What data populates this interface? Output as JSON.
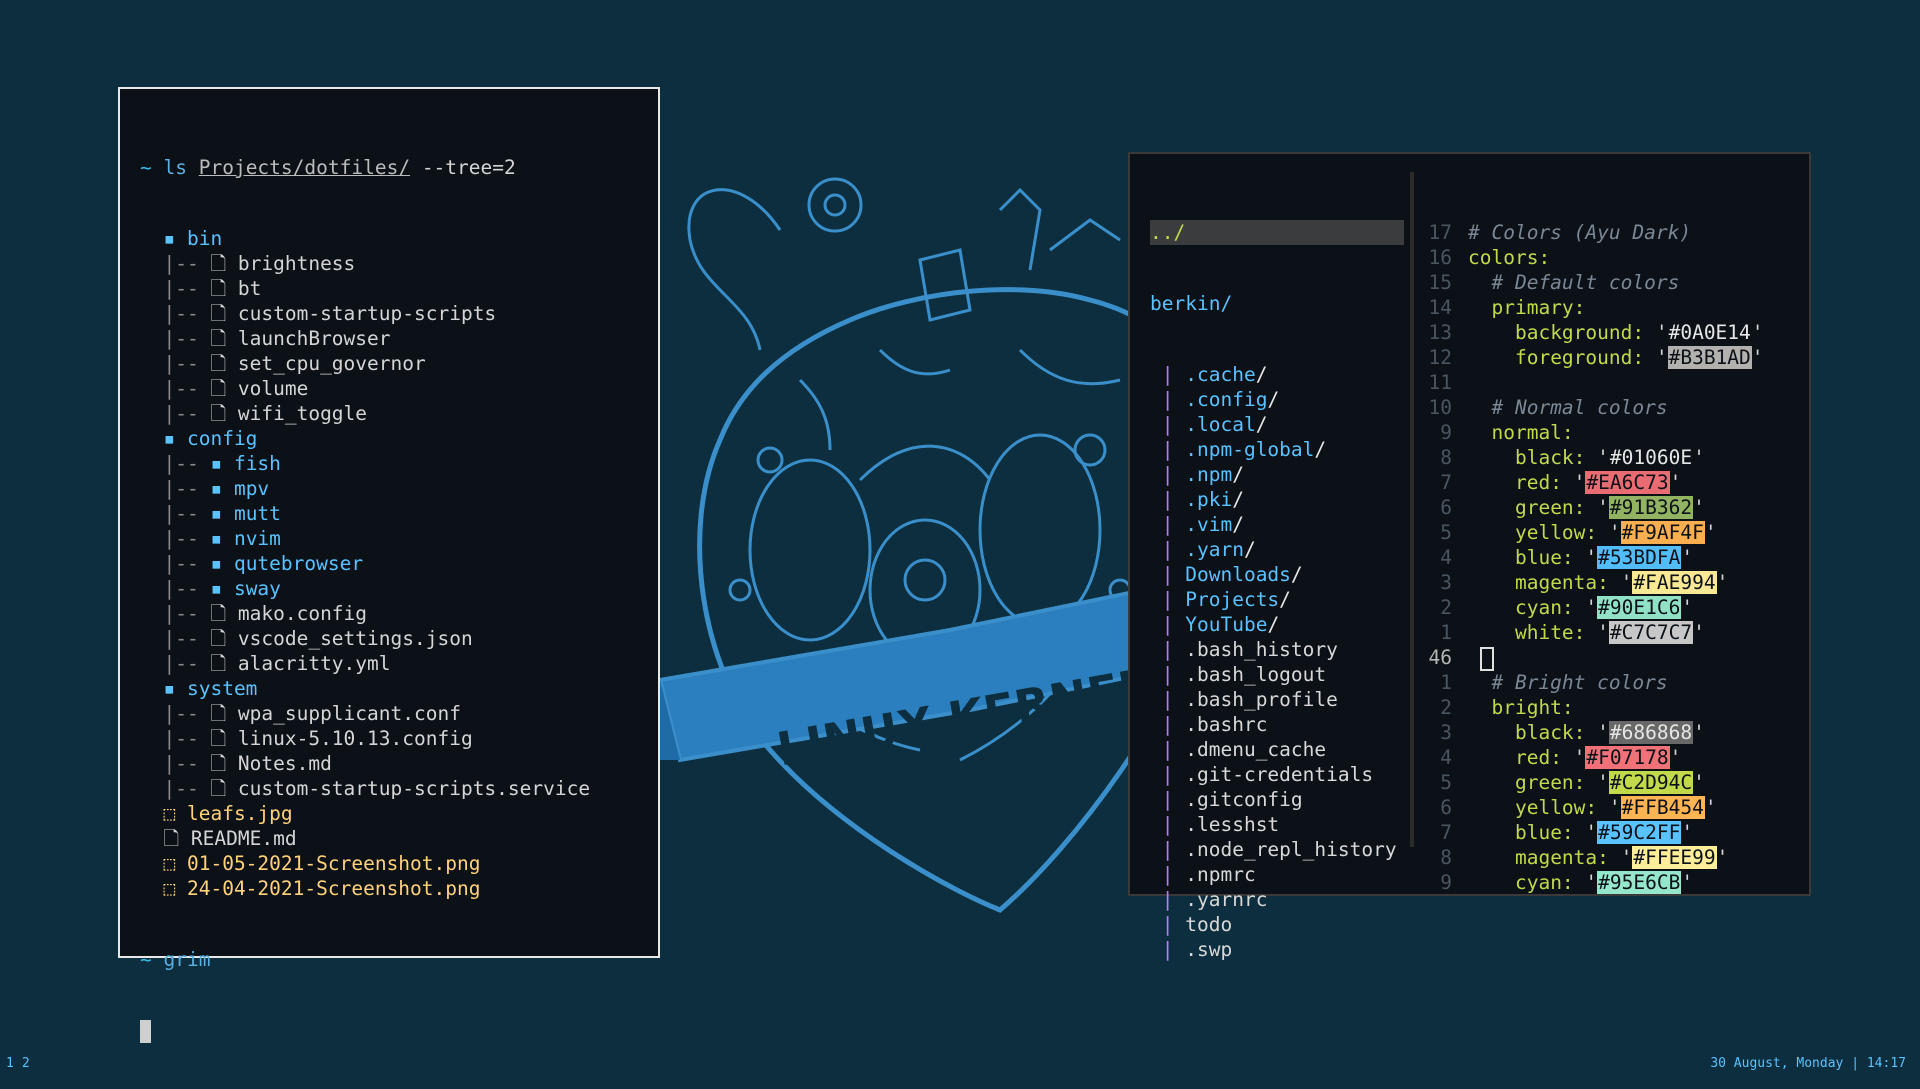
{
  "terminal": {
    "command_prompt": "~",
    "command": "ls",
    "command_path": "Projects/dotfiles/",
    "command_flags": "--tree=2",
    "entries": [
      {
        "prefix": "  ",
        "icon": "▪",
        "name": "bin",
        "kind": "dir"
      },
      {
        "prefix": "  |-- ",
        "icon": "🗋",
        "name": "brightness",
        "kind": "file"
      },
      {
        "prefix": "  |-- ",
        "icon": "🗋",
        "name": "bt",
        "kind": "file"
      },
      {
        "prefix": "  |-- ",
        "icon": "🗋",
        "name": "custom-startup-scripts",
        "kind": "file"
      },
      {
        "prefix": "  |-- ",
        "icon": "🗋",
        "name": "launchBrowser",
        "kind": "file"
      },
      {
        "prefix": "  |-- ",
        "icon": "🗋",
        "name": "set_cpu_governor",
        "kind": "file"
      },
      {
        "prefix": "  |-- ",
        "icon": "🗋",
        "name": "volume",
        "kind": "file"
      },
      {
        "prefix": "  |-- ",
        "icon": "🗋",
        "name": "wifi_toggle",
        "kind": "file"
      },
      {
        "prefix": "  ",
        "icon": "▪",
        "name": "config",
        "kind": "dir"
      },
      {
        "prefix": "  |-- ",
        "icon": "▪",
        "name": "fish",
        "kind": "dir"
      },
      {
        "prefix": "  |-- ",
        "icon": "▪",
        "name": "mpv",
        "kind": "dir"
      },
      {
        "prefix": "  |-- ",
        "icon": "▪",
        "name": "mutt",
        "kind": "dir"
      },
      {
        "prefix": "  |-- ",
        "icon": "▪",
        "name": "nvim",
        "kind": "dir"
      },
      {
        "prefix": "  |-- ",
        "icon": "▪",
        "name": "qutebrowser",
        "kind": "dir"
      },
      {
        "prefix": "  |-- ",
        "icon": "▪",
        "name": "sway",
        "kind": "dir"
      },
      {
        "prefix": "  |-- ",
        "icon": "🗋",
        "name": "mako.config",
        "kind": "file"
      },
      {
        "prefix": "  |-- ",
        "icon": "🗋",
        "name": "vscode_settings.json",
        "kind": "file"
      },
      {
        "prefix": "  |-- ",
        "icon": "🗋",
        "name": "alacritty.yml",
        "kind": "file"
      },
      {
        "prefix": "  ",
        "icon": "▪",
        "name": "system",
        "kind": "dir"
      },
      {
        "prefix": "  |-- ",
        "icon": "🗋",
        "name": "wpa_supplicant.conf",
        "kind": "file"
      },
      {
        "prefix": "  |-- ",
        "icon": "🗋",
        "name": "linux-5.10.13.config",
        "kind": "file"
      },
      {
        "prefix": "  |-- ",
        "icon": "🗋",
        "name": "Notes.md",
        "kind": "file"
      },
      {
        "prefix": "  |-- ",
        "icon": "🗋",
        "name": "custom-startup-scripts.service",
        "kind": "file"
      },
      {
        "prefix": "  ",
        "icon": "⬚",
        "name": "leafs.jpg",
        "kind": "img"
      },
      {
        "prefix": "  ",
        "icon": "🗋",
        "name": "README.md",
        "kind": "file"
      },
      {
        "prefix": "  ",
        "icon": "⬚",
        "name": "01-05-2021-Screenshot.png",
        "kind": "img"
      },
      {
        "prefix": "  ",
        "icon": "⬚",
        "name": "24-04-2021-Screenshot.png",
        "kind": "img"
      }
    ],
    "second_prompt": "~",
    "second_command": "grim"
  },
  "wallpaper": {
    "banner_text": "LINUX KERNEL"
  },
  "file_manager": {
    "parent": "../",
    "current_dir": "berkin/",
    "items": [
      {
        "name": ".cache",
        "dir": true
      },
      {
        "name": ".config",
        "dir": true
      },
      {
        "name": ".local",
        "dir": true
      },
      {
        "name": ".npm-global",
        "dir": true
      },
      {
        "name": ".npm",
        "dir": true
      },
      {
        "name": ".pki",
        "dir": true
      },
      {
        "name": ".vim",
        "dir": true
      },
      {
        "name": ".yarn",
        "dir": true
      },
      {
        "name": "Downloads",
        "dir": true
      },
      {
        "name": "Projects",
        "dir": true
      },
      {
        "name": "YouTube",
        "dir": true
      },
      {
        "name": ".bash_history",
        "dir": false
      },
      {
        "name": ".bash_logout",
        "dir": false
      },
      {
        "name": ".bash_profile",
        "dir": false
      },
      {
        "name": ".bashrc",
        "dir": false
      },
      {
        "name": ".dmenu_cache",
        "dir": false
      },
      {
        "name": ".git-credentials",
        "dir": false
      },
      {
        "name": ".gitconfig",
        "dir": false
      },
      {
        "name": ".lesshst",
        "dir": false
      },
      {
        "name": ".node_repl_history",
        "dir": false
      },
      {
        "name": ".npmrc",
        "dir": false
      },
      {
        "name": ".yarnrc",
        "dir": false
      },
      {
        "name": "todo",
        "dir": false
      },
      {
        "name": ".swp",
        "dir": false
      }
    ],
    "dir_suffix": "/",
    "pipe": "|"
  },
  "editor": {
    "lines": [
      {
        "ln": "17",
        "indent": "",
        "type": "comment",
        "text": "# Colors (Ayu Dark)"
      },
      {
        "ln": "16",
        "indent": "",
        "type": "key",
        "key": "colors:"
      },
      {
        "ln": "15",
        "indent": "  ",
        "type": "comment",
        "text": "# Default colors"
      },
      {
        "ln": "14",
        "indent": "  ",
        "type": "key",
        "key": "primary:"
      },
      {
        "ln": "13",
        "indent": "    ",
        "type": "kv",
        "key": "background:",
        "value": "#0A0E14",
        "bg": "",
        "fg": "#e6e6e6"
      },
      {
        "ln": "12",
        "indent": "    ",
        "type": "kv",
        "key": "foreground:",
        "value": "#B3B1AD",
        "bg": "#B3B1AD",
        "fg": "#0b1117"
      },
      {
        "ln": "11",
        "indent": "",
        "type": "blank"
      },
      {
        "ln": "10",
        "indent": "  ",
        "type": "comment",
        "text": "# Normal colors"
      },
      {
        "ln": "9",
        "indent": "  ",
        "type": "key",
        "key": "normal:"
      },
      {
        "ln": "8",
        "indent": "    ",
        "type": "kv",
        "key": "black:",
        "value": "#01060E",
        "bg": "",
        "fg": "#e6e6e6"
      },
      {
        "ln": "7",
        "indent": "    ",
        "type": "kv",
        "key": "red:",
        "value": "#EA6C73",
        "bg": "#EA6C73",
        "fg": "#0b1117"
      },
      {
        "ln": "6",
        "indent": "    ",
        "type": "kv",
        "key": "green:",
        "value": "#91B362",
        "bg": "#91B362",
        "fg": "#0b1117"
      },
      {
        "ln": "5",
        "indent": "    ",
        "type": "kv",
        "key": "yellow:",
        "value": "#F9AF4F",
        "bg": "#F9AF4F",
        "fg": "#0b1117"
      },
      {
        "ln": "4",
        "indent": "    ",
        "type": "kv",
        "key": "blue:",
        "value": "#53BDFA",
        "bg": "#53BDFA",
        "fg": "#0b1117"
      },
      {
        "ln": "3",
        "indent": "    ",
        "type": "kv",
        "key": "magenta:",
        "value": "#FAE994",
        "bg": "#FAE994",
        "fg": "#0b1117"
      },
      {
        "ln": "2",
        "indent": "    ",
        "type": "kv",
        "key": "cyan:",
        "value": "#90E1C6",
        "bg": "#90E1C6",
        "fg": "#0b1117"
      },
      {
        "ln": "1",
        "indent": "    ",
        "type": "kv",
        "key": "white:",
        "value": "#C7C7C7",
        "bg": "#C7C7C7",
        "fg": "#0b1117"
      },
      {
        "ln": "46",
        "indent": "",
        "type": "cursor",
        "current": true
      },
      {
        "ln": "1",
        "indent": "  ",
        "type": "comment",
        "text": "# Bright colors"
      },
      {
        "ln": "2",
        "indent": "  ",
        "type": "key",
        "key": "bright:"
      },
      {
        "ln": "3",
        "indent": "    ",
        "type": "kv",
        "key": "black:",
        "value": "#686868",
        "bg": "#686868",
        "fg": "#e6e6e6"
      },
      {
        "ln": "4",
        "indent": "    ",
        "type": "kv",
        "key": "red:",
        "value": "#F07178",
        "bg": "#F07178",
        "fg": "#0b1117"
      },
      {
        "ln": "5",
        "indent": "    ",
        "type": "kv",
        "key": "green:",
        "value": "#C2D94C",
        "bg": "#C2D94C",
        "fg": "#0b1117"
      },
      {
        "ln": "6",
        "indent": "    ",
        "type": "kv",
        "key": "yellow:",
        "value": "#FFB454",
        "bg": "#FFB454",
        "fg": "#0b1117"
      },
      {
        "ln": "7",
        "indent": "    ",
        "type": "kv",
        "key": "blue:",
        "value": "#59C2FF",
        "bg": "#59C2FF",
        "fg": "#0b1117"
      },
      {
        "ln": "8",
        "indent": "    ",
        "type": "kv",
        "key": "magenta:",
        "value": "#FFEE99",
        "bg": "#FFEE99",
        "fg": "#0b1117"
      },
      {
        "ln": "9",
        "indent": "    ",
        "type": "kv",
        "key": "cyan:",
        "value": "#95E6CB",
        "bg": "#95E6CB",
        "fg": "#0b1117"
      }
    ]
  },
  "statusbar": {
    "workspaces": [
      "1",
      "2"
    ],
    "date": "30 August, Monday",
    "separator": "|",
    "time": "14:17"
  },
  "colors": {
    "desktop_bg": "#0d2e3e",
    "accent": "#59c2ff",
    "keys": "#c2d94c",
    "pipe": "#b47eff"
  }
}
